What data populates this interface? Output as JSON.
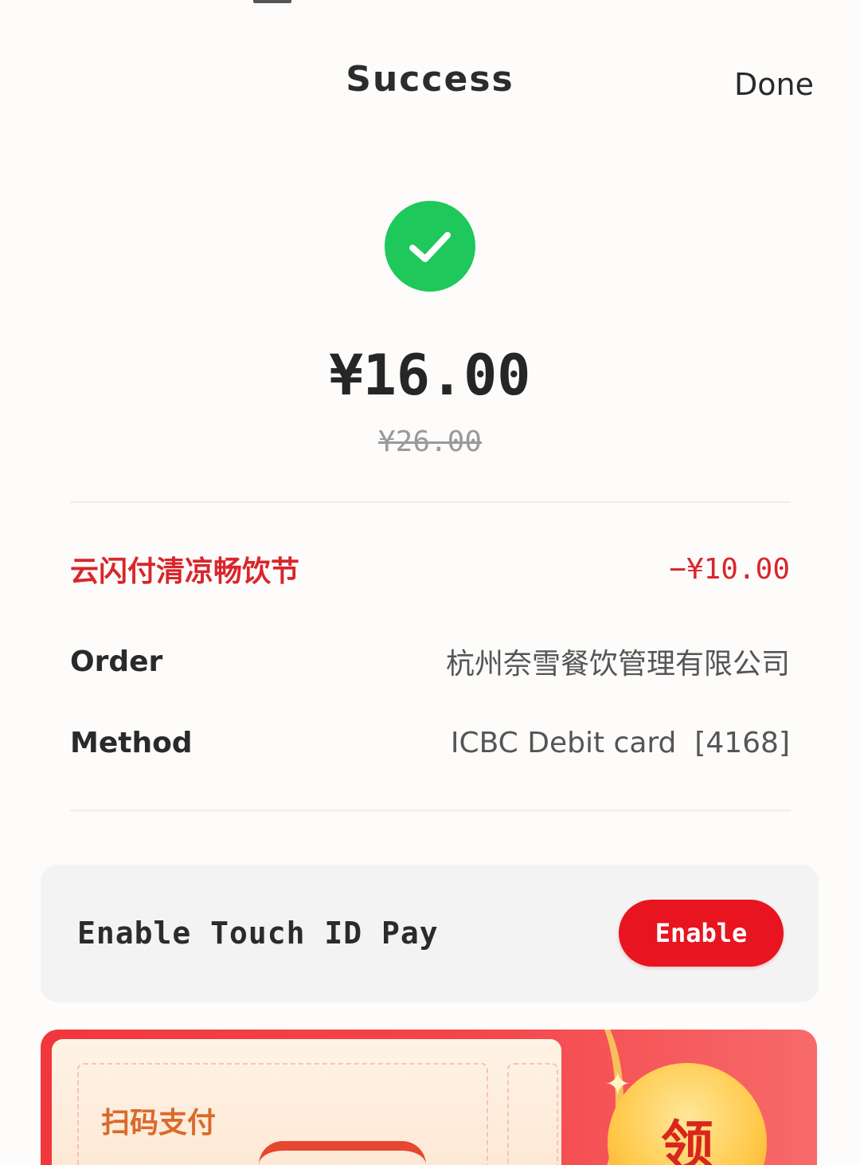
{
  "header": {
    "title": "Success",
    "done_label": "Done"
  },
  "payment": {
    "amount": "¥16.00",
    "original_amount": "¥26.00"
  },
  "promotion": {
    "label": "云闪付清凉畅饮节",
    "discount": "−¥10.00"
  },
  "details": {
    "order_label": "Order",
    "order_value": "杭州奈雪餐饮管理有限公司",
    "method_label": "Method",
    "method_value": "ICBC Debit card  [4168]"
  },
  "touch_id": {
    "text": "Enable Touch ID Pay",
    "button_label": "Enable"
  },
  "banner": {
    "coupon_title": "扫码支付",
    "claim_label": "领"
  },
  "colors": {
    "success_green": "#1fc85b",
    "promo_red": "#d8262c",
    "button_red": "#e8141f",
    "banner_red": "#f0383c"
  },
  "icons": {
    "success": "checkmark-icon"
  }
}
